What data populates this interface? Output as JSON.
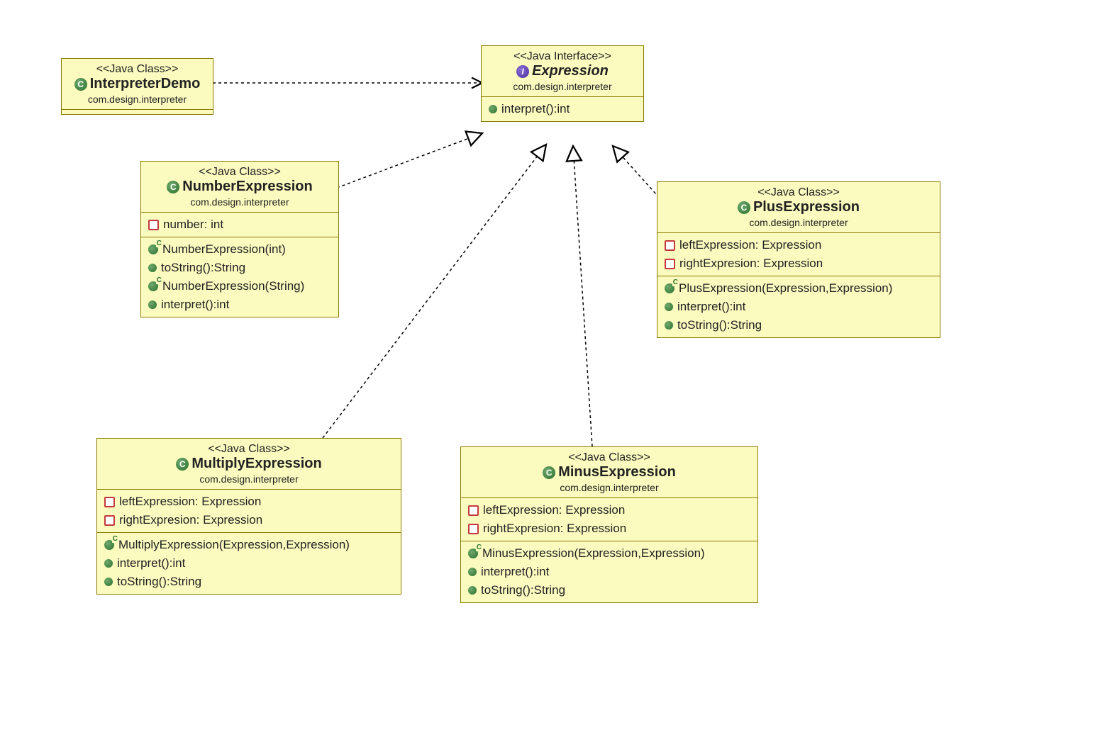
{
  "stereotypes": {
    "javaClass": "<<Java Class>>",
    "javaInterface": "<<Java Interface>>"
  },
  "pkg": "com.design.interpreter",
  "classes": {
    "interpreterDemo": {
      "name": "InterpreterDemo"
    },
    "expression": {
      "name": "Expression",
      "methods": {
        "interpret": "interpret():int"
      }
    },
    "numberExpression": {
      "name": "NumberExpression",
      "fields": {
        "number": "number: int"
      },
      "methods": {
        "ctor1": "NumberExpression(int)",
        "toString": "toString():String",
        "ctor2": "NumberExpression(String)",
        "interpret": "interpret():int"
      }
    },
    "plusExpression": {
      "name": "PlusExpression",
      "fields": {
        "left": "leftExpression: Expression",
        "right": "rightExpresion: Expression"
      },
      "methods": {
        "ctor": "PlusExpression(Expression,Expression)",
        "interpret": "interpret():int",
        "toString": "toString():String"
      }
    },
    "multiplyExpression": {
      "name": "MultiplyExpression",
      "fields": {
        "left": "leftExpression: Expression",
        "right": "rightExpresion: Expression"
      },
      "methods": {
        "ctor": "MultiplyExpression(Expression,Expression)",
        "interpret": "interpret():int",
        "toString": "toString():String"
      }
    },
    "minusExpression": {
      "name": "MinusExpression",
      "fields": {
        "left": "leftExpression: Expression",
        "right": "rightExpresion: Expression"
      },
      "methods": {
        "ctor": "MinusExpression(Expression,Expression)",
        "interpret": "interpret():int",
        "toString": "toString():String"
      }
    }
  },
  "relationships": [
    {
      "from": "InterpreterDemo",
      "to": "Expression",
      "type": "dependency"
    },
    {
      "from": "NumberExpression",
      "to": "Expression",
      "type": "realization"
    },
    {
      "from": "PlusExpression",
      "to": "Expression",
      "type": "realization"
    },
    {
      "from": "MultiplyExpression",
      "to": "Expression",
      "type": "realization"
    },
    {
      "from": "MinusExpression",
      "to": "Expression",
      "type": "realization"
    }
  ]
}
